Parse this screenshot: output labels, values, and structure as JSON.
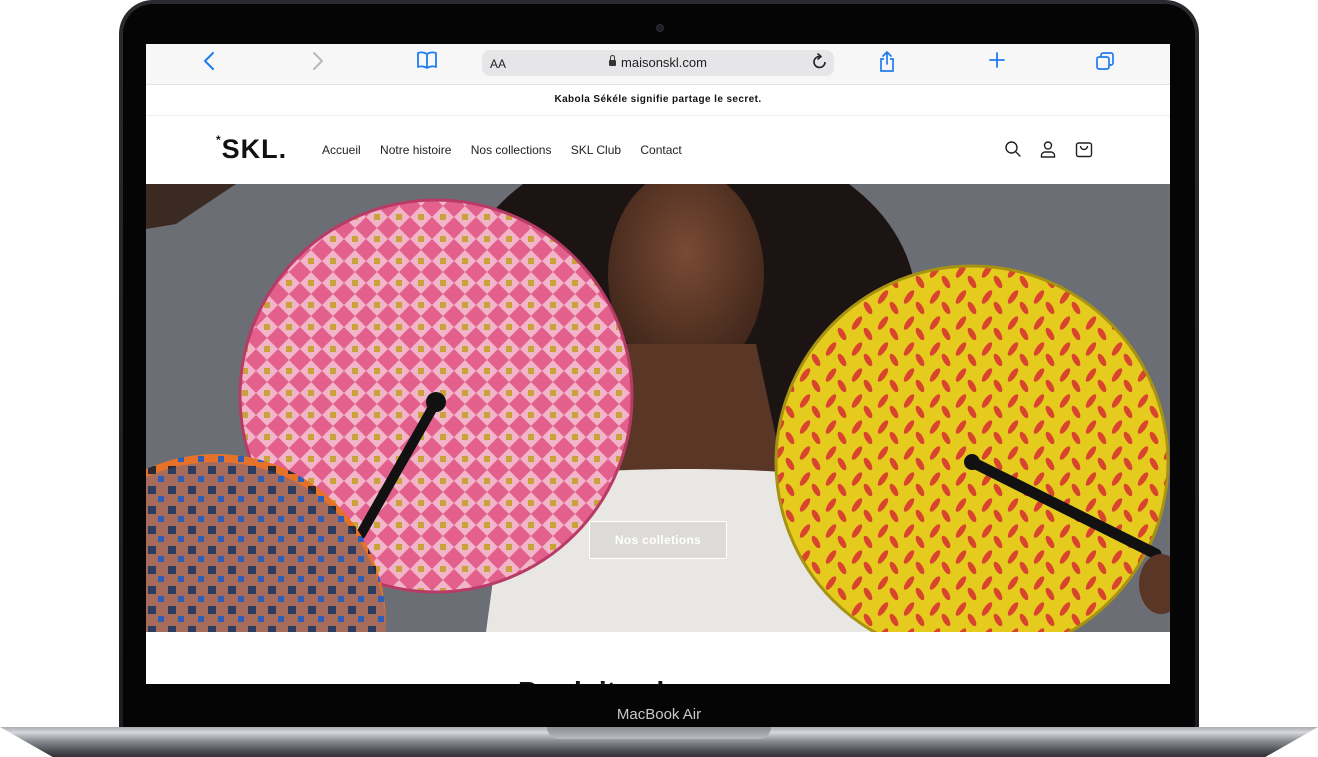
{
  "device": {
    "label": "MacBook Air"
  },
  "browser": {
    "text_size_label": "AA",
    "url": "maisonskl.com",
    "accent": "#1f7bf0"
  },
  "site": {
    "announcement": "Kabola Sékéle signifie partage le secret.",
    "logo": {
      "star": "*",
      "text": "SKL."
    },
    "nav": [
      {
        "label": "Accueil"
      },
      {
        "label": "Notre histoire"
      },
      {
        "label": "Nos collections"
      },
      {
        "label": "SKL Club"
      },
      {
        "label": "Contact"
      }
    ],
    "hero": {
      "button_label": "Nos colletions"
    },
    "section_heading_partial": "Produits phares"
  }
}
